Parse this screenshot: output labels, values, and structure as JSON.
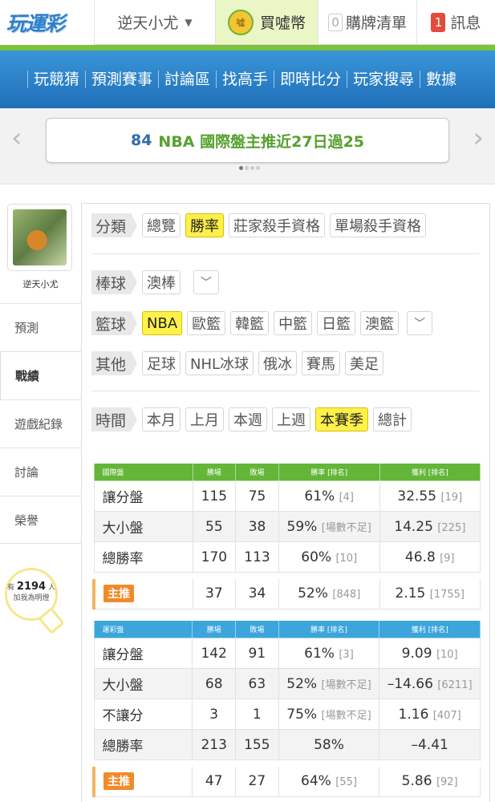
{
  "header": {
    "logo": "玩運彩",
    "username": "逆天小尤",
    "coin_label": "買噓幣",
    "coin_icon": "噓",
    "cart_count": "0",
    "cart_label": "購牌清單",
    "msg_count": "1",
    "msg_label": "訊息"
  },
  "nav": [
    "玩競猜",
    "預測賽事",
    "討論區",
    "找高手",
    "即時比分",
    "玩家搜尋",
    "數據"
  ],
  "banner": {
    "number": "84",
    "text": "NBA 國際盤主推近27日過25"
  },
  "sidebar": {
    "username": "逆天小尤",
    "items": [
      "預測",
      "戰績",
      "遊戲紀錄",
      "討論",
      "榮譽"
    ],
    "active": "戰績",
    "fans_prefix": "有",
    "fans_count": "2194",
    "fans_suffix": "人",
    "fans_line2": "加我為明燈"
  },
  "filters": {
    "category_label": "分類",
    "category_options": [
      "總覽",
      "勝率",
      "莊家殺手資格",
      "單場殺手資格"
    ],
    "category_selected": "勝率",
    "baseball_label": "棒球",
    "baseball_options": [
      "澳棒"
    ],
    "basketball_label": "籃球",
    "basketball_options": [
      "NBA",
      "歐籃",
      "韓籃",
      "中籃",
      "日籃",
      "澳籃"
    ],
    "basketball_selected": "NBA",
    "other_label": "其他",
    "other_options": [
      "足球",
      "NHL冰球",
      "俄冰",
      "賽馬",
      "美足"
    ],
    "time_label": "時間",
    "time_options": [
      "本月",
      "上月",
      "本週",
      "上週",
      "本賽季",
      "總計"
    ],
    "time_selected": "本賽季"
  },
  "intl_table": {
    "headers": [
      "國際盤",
      "勝場",
      "敗場",
      "勝率 [排名]",
      "獲利 [排名]"
    ],
    "rows": [
      {
        "name": "讓分盤",
        "win": "115",
        "lose": "75",
        "rate": "61%",
        "rate_rank": "[4]",
        "profit": "32.55",
        "profit_rank": "[19]"
      },
      {
        "name": "大小盤",
        "win": "55",
        "lose": "38",
        "rate": "59%",
        "rate_rank": "[場數不足]",
        "profit": "14.25",
        "profit_rank": "[225]"
      },
      {
        "name": "總勝率",
        "win": "170",
        "lose": "113",
        "rate": "60%",
        "rate_rank": "[10]",
        "profit": "46.8",
        "profit_rank": "[9]"
      }
    ],
    "main_pick": {
      "name": "主推",
      "win": "37",
      "lose": "34",
      "rate": "52%",
      "rate_rank": "[848]",
      "profit": "2.15",
      "profit_rank": "[1755]"
    }
  },
  "lottery_table": {
    "headers": [
      "運彩盤",
      "勝場",
      "敗場",
      "勝率 [排名]",
      "獲利 [排名]"
    ],
    "rows": [
      {
        "name": "讓分盤",
        "win": "142",
        "lose": "91",
        "rate": "61%",
        "rate_rank": "[3]",
        "profit": "9.09",
        "profit_rank": "[10]"
      },
      {
        "name": "大小盤",
        "win": "68",
        "lose": "63",
        "rate": "52%",
        "rate_rank": "[場數不足]",
        "profit": "–14.66",
        "profit_rank": "[6211]"
      },
      {
        "name": "不讓分",
        "win": "3",
        "lose": "1",
        "rate": "75%",
        "rate_rank": "[場數不足]",
        "profit": "1.16",
        "profit_rank": "[407]"
      },
      {
        "name": "總勝率",
        "win": "213",
        "lose": "155",
        "rate": "58%",
        "rate_rank": "",
        "profit": "–4.41",
        "profit_rank": ""
      }
    ],
    "main_pick": {
      "name": "主推",
      "win": "47",
      "lose": "27",
      "rate": "64%",
      "rate_rank": "[55]",
      "profit": "5.86",
      "profit_rank": "[92]"
    }
  },
  "colors": {
    "brand_blue": "#2f7fc9",
    "accent_green": "#7dc13d",
    "highlight": "#fff04a",
    "intl_header": "#63b637",
    "lottery_header": "#3ba5dc",
    "pick_badge": "#f28a2a"
  }
}
